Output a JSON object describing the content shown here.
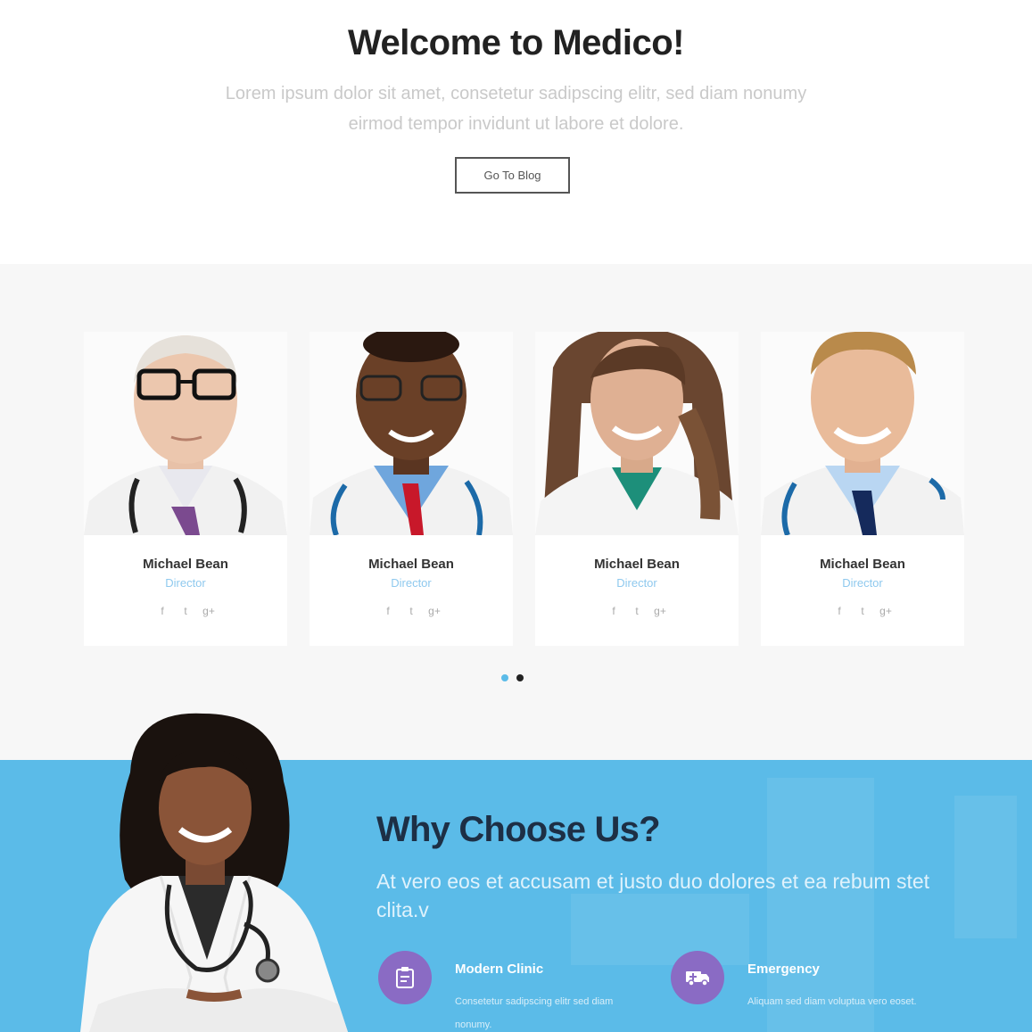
{
  "welcome": {
    "title": "Welcome to Medico!",
    "text": "Lorem ipsum dolor sit amet, consetetur sadipscing elitr, sed diam nonumy eirmod tempor invidunt ut labore et dolore.",
    "button_label": "Go To Blog"
  },
  "team": {
    "members": [
      {
        "name": "Michael Bean",
        "role": "Director"
      },
      {
        "name": "Michael Bean",
        "role": "Director"
      },
      {
        "name": "Michael Bean",
        "role": "Director"
      },
      {
        "name": "Michael Bean",
        "role": "Director"
      }
    ],
    "social_icons": [
      "facebook-icon",
      "twitter-icon",
      "google-plus-icon"
    ],
    "social_glyphs": {
      "facebook": "f",
      "twitter": "t",
      "google_plus": "g+"
    },
    "carousel": {
      "pages": 2,
      "active_index": 0
    }
  },
  "why": {
    "title": "Why Choose Us?",
    "text": "At vero eos et accusam et justo duo dolores et ea rebum stet clita.v",
    "features": [
      {
        "title": "Modern Clinic",
        "text": "Consetetur sadipscing elitr sed diam nonumy.",
        "icon": "clipboard-icon"
      },
      {
        "title": "Emergency",
        "text": "Aliquam sed diam voluptua vero eoset.",
        "icon": "ambulance-icon"
      }
    ]
  },
  "colors": {
    "accent_blue": "#5bbbe8",
    "role_blue": "#8fc9ee",
    "feature_purple": "#8a6bc4",
    "dot_active": "#5bbbe8",
    "dot_inactive": "#222222"
  }
}
